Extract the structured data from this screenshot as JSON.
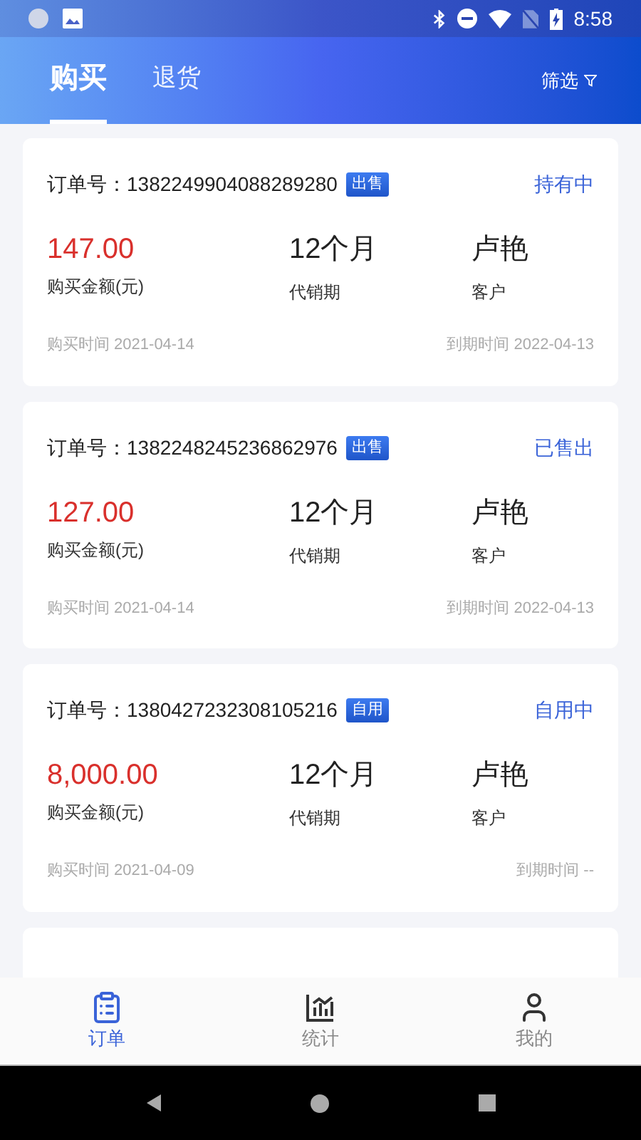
{
  "status_bar": {
    "time": "8:58"
  },
  "tabs": [
    {
      "label": "购买",
      "selected": true
    },
    {
      "label": "退货",
      "selected": false
    }
  ],
  "filter": {
    "label": "筛选"
  },
  "orders": [
    {
      "order_label": "订单号：",
      "order_no": "1382249904088289280",
      "badge": "出售",
      "status": "持有中",
      "amount": "147.00",
      "amount_label": "购买金额(元)",
      "period": "12个月",
      "period_label": "代销期",
      "customer": "卢艳",
      "customer_label": "客户",
      "buy_time": "购买时间 2021-04-14",
      "expire_time": "到期时间 2022-04-13"
    },
    {
      "order_label": "订单号：",
      "order_no": "1382248245236862976",
      "badge": "出售",
      "status": "已售出",
      "amount": "127.00",
      "amount_label": "购买金额(元)",
      "period": "12个月",
      "period_label": "代销期",
      "customer": "卢艳",
      "customer_label": "客户",
      "buy_time": "购买时间 2021-04-14",
      "expire_time": "到期时间 2022-04-13"
    },
    {
      "order_label": "订单号：",
      "order_no": "1380427232308105216",
      "badge": "自用",
      "status": "自用中",
      "amount": "8,000.00",
      "amount_label": "购买金额(元)",
      "period": "12个月",
      "period_label": "代销期",
      "customer": "卢艳",
      "customer_label": "客户",
      "buy_time": "购买时间 2021-04-09",
      "expire_time": "到期时间 --"
    }
  ],
  "bottom_nav": [
    {
      "label": "订单",
      "kind": "orders",
      "selected": true
    },
    {
      "label": "统计",
      "kind": "stats",
      "selected": false
    },
    {
      "label": "我的",
      "kind": "profile",
      "selected": false
    }
  ]
}
